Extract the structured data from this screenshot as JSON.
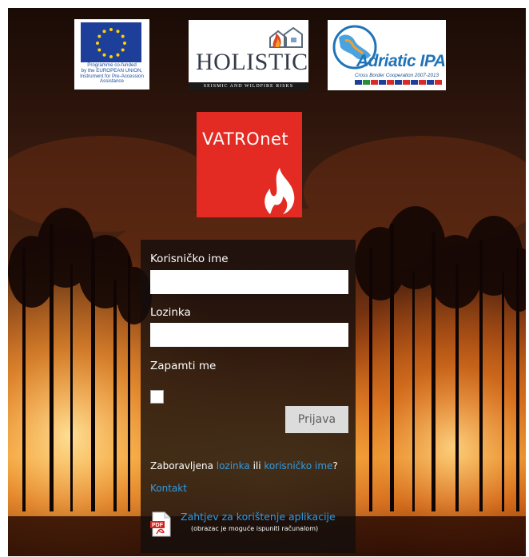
{
  "logos": {
    "eu": {
      "lines": [
        "Programme co-funded",
        "by the EUROPEAN UNION,",
        "Instrument for Pre-Accession",
        "Assistance"
      ],
      "color": "#1d4fa3"
    },
    "holistic": {
      "name": "HOLISTIC",
      "tagline": "SEISMIC AND WILDFIRE RISKS"
    },
    "adriatic": {
      "name": "Adriatic IPA",
      "tagline": "Cross Border Cooperation 2007-2013"
    },
    "vatronet": {
      "name": "VATROnet",
      "color": "#e32b24"
    }
  },
  "login": {
    "username_label": "Korisničko ime",
    "username_value": "",
    "password_label": "Lozinka",
    "password_value": "",
    "remember_label": "Zapamti me",
    "remember_checked": false,
    "submit_label": "Prijava",
    "forgot_prefix": "Zaboravljena ",
    "forgot_password_link": "lozinka",
    "forgot_or": " ili ",
    "forgot_username_link": "korisničko ime",
    "forgot_suffix": "?",
    "contact_link": "Kontakt",
    "request_link": "Zahtjev za korištenje aplikacije",
    "request_note": "(obrazac je moguće ispuniti računalom)",
    "pdf_icon_label": "PDF"
  },
  "colors": {
    "link": "#2e9ce6",
    "panel": "#140e0c",
    "button": "#dcdcdc"
  }
}
